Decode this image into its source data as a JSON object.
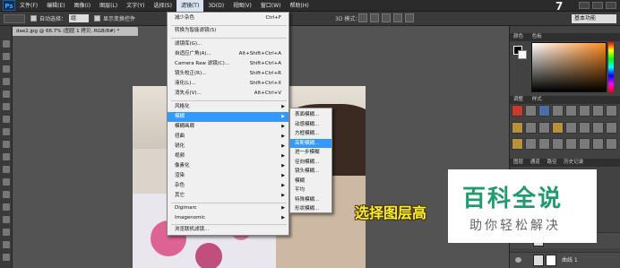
{
  "menubar": {
    "logo": "Ps",
    "items": [
      "文件(F)",
      "编辑(E)",
      "图像(I)",
      "图层(L)",
      "文字(Y)",
      "选择(S)",
      "滤镜(T)",
      "3D(D)",
      "视图(V)",
      "窗口(W)",
      "帮助(H)"
    ],
    "active_index": 6,
    "step_number": "7"
  },
  "options_bar": {
    "auto_select_label": "自动选择：",
    "auto_select_value": "组",
    "show_transform_label": "显示变换控件",
    "mode_3d_label": "3D 模式：",
    "workspace": "基本功能"
  },
  "document_tab": {
    "title": "dae2.jpg @ 66.7% (图层 1 拷贝, RGB/8#) *"
  },
  "filter_menu": {
    "items": [
      {
        "label": "减少杂色",
        "shortcut": "Ctrl+F"
      },
      {
        "label": "转换为智能滤镜(S)",
        "shortcut": ""
      },
      {
        "label": "滤镜库(G)...",
        "shortcut": ""
      },
      {
        "label": "自适应广角(A)...",
        "shortcut": "Alt+Shift+Ctrl+A"
      },
      {
        "label": "Camera Raw 滤镜(C)...",
        "shortcut": "Shift+Ctrl+A"
      },
      {
        "label": "镜头校正(R)...",
        "shortcut": "Shift+Ctrl+R"
      },
      {
        "label": "液化(L)...",
        "shortcut": "Shift+Ctrl+X"
      },
      {
        "label": "消失点(V)...",
        "shortcut": "Alt+Ctrl+V"
      },
      {
        "label": "风格化",
        "shortcut": ""
      },
      {
        "label": "模糊",
        "shortcut": ""
      },
      {
        "label": "模糊画廊",
        "shortcut": ""
      },
      {
        "label": "扭曲",
        "shortcut": ""
      },
      {
        "label": "锐化",
        "shortcut": ""
      },
      {
        "label": "视频",
        "shortcut": ""
      },
      {
        "label": "像素化",
        "shortcut": ""
      },
      {
        "label": "渲染",
        "shortcut": ""
      },
      {
        "label": "杂色",
        "shortcut": ""
      },
      {
        "label": "其它",
        "shortcut": ""
      },
      {
        "label": "Digimarc",
        "shortcut": ""
      },
      {
        "label": "Imagenomic",
        "shortcut": ""
      },
      {
        "label": "浏览联机滤镜...",
        "shortcut": ""
      }
    ]
  },
  "blur_submenu": {
    "items": [
      "表面模糊...",
      "动感模糊...",
      "方框模糊...",
      "高斯模糊...",
      "进一步模糊",
      "径向模糊...",
      "镜头模糊...",
      "模糊",
      "平均",
      "特殊模糊...",
      "形状模糊..."
    ],
    "highlighted_index": 3
  },
  "caption": "选择图层高",
  "right_panel": {
    "color_tab": "颜色",
    "swatches_tab": "色板",
    "adjust_tab": "调整",
    "styles_tab": "样式",
    "layers_tabs": [
      "图层",
      "通道",
      "路径",
      "历史记录"
    ],
    "layer_rows": [
      {
        "name": ""
      },
      {
        "name": "曲线 1"
      }
    ]
  },
  "watermark": {
    "title": "百科全说",
    "subtitle": "助你轻松解决"
  }
}
